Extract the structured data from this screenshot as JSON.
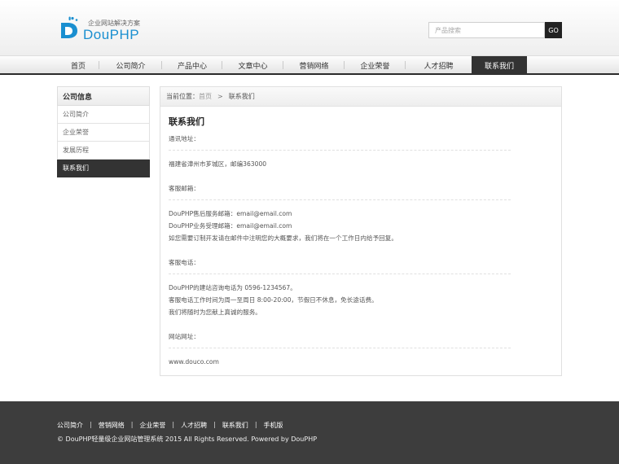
{
  "header": {
    "logo_sub": "企业网站解决方案",
    "logo_text": "DouPHP",
    "logo_icon": "doupHP-logo-icon",
    "search_placeholder": "产品搜索",
    "search_button": "GO"
  },
  "nav": {
    "items": [
      "首页",
      "公司简介",
      "产品中心",
      "文章中心",
      "营销网络",
      "企业荣誉",
      "人才招聘",
      "联系我们"
    ],
    "active": "联系我们"
  },
  "sidebar": {
    "title": "公司信息",
    "items": [
      "公司简介",
      "企业荣誉",
      "发展历程",
      "联系我们"
    ],
    "active": "联系我们"
  },
  "breadcrumb": {
    "prefix": "当前位置：",
    "home": "首页",
    "separator": ">",
    "current": "联系我们"
  },
  "content": {
    "title": "联系我们",
    "address_label": "通讯地址：",
    "address": "福建省漳州市芗城区，邮编363000",
    "email_label": "客服邮箱：",
    "email_lines": [
      "DouPHP售后服务邮箱：email@email.com",
      "DouPHP业务受理邮箱：email@email.com",
      "如您需要订制开发请在邮件中注明您的大概要求，我们将在一个工作日内给予回复。"
    ],
    "phone_label": "客服电话：",
    "phone_lines": [
      "DouPHP的建站咨询电话为 0596-1234567。",
      "客服电话工作时间为周一至周日 8:00-20:00，节假日不休息，免长途话费。",
      "我们将随时为您献上真诚的服务。"
    ],
    "site_label": "网站网址：",
    "site": "www.douco.com"
  },
  "footer": {
    "links": [
      "公司简介",
      "营销网络",
      "企业荣誉",
      "人才招聘",
      "联系我们",
      "手机版"
    ],
    "separator": "|",
    "copyright": "© DouPHP轻量级企业网站管理系统 2015 All Rights Reserved. Powered by DouPHP"
  },
  "colors": {
    "brand_blue": "#1a8fd0",
    "nav_active": "#333333",
    "footer_bg": "#3d3d3d"
  }
}
